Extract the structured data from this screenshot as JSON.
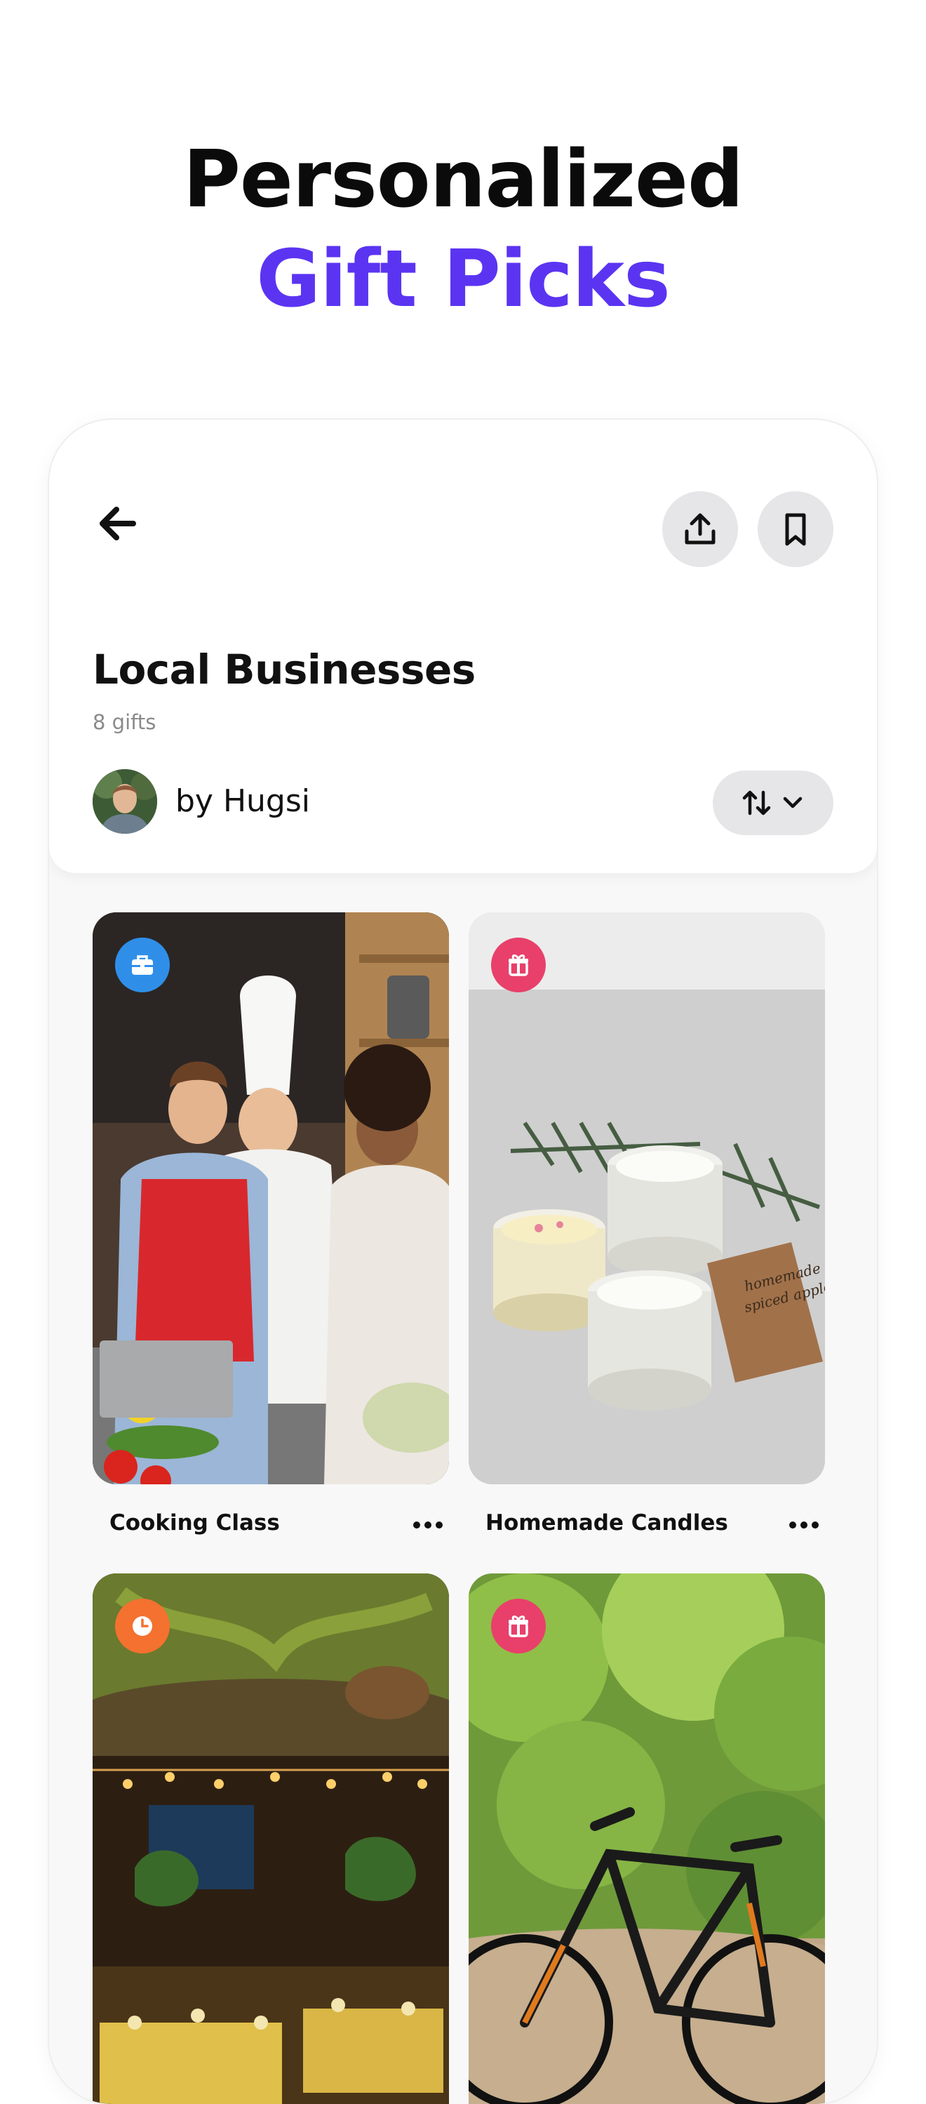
{
  "hero": {
    "line1": "Personalized",
    "line2": "Gift Picks"
  },
  "collection": {
    "title": "Local Businesses",
    "count_text": "8 gifts",
    "author_text": "by Hugsi"
  },
  "icons": {
    "back": "arrow-left-icon",
    "share": "share-upload-icon",
    "bookmark": "bookmark-icon",
    "sort": "sort-arrows-icon",
    "chevron": "chevron-down-icon",
    "more": "more-horizontal-icon"
  },
  "colors": {
    "accent": "#5b34f2",
    "badge_experience": "#2f8fe8",
    "badge_handmade": "#e8406a",
    "badge_time": "#f4712f"
  },
  "gifts": [
    {
      "label": "Cooking Class",
      "badge": "briefcase-icon",
      "badge_color": "#2f8fe8"
    },
    {
      "label": "Homemade Candles",
      "badge": "gift-box-icon",
      "badge_color": "#e8406a"
    },
    {
      "label": "",
      "badge": "clock-icon",
      "badge_color": "#f4712f"
    },
    {
      "label": "",
      "badge": "gift-box-icon",
      "badge_color": "#e8406a"
    }
  ]
}
